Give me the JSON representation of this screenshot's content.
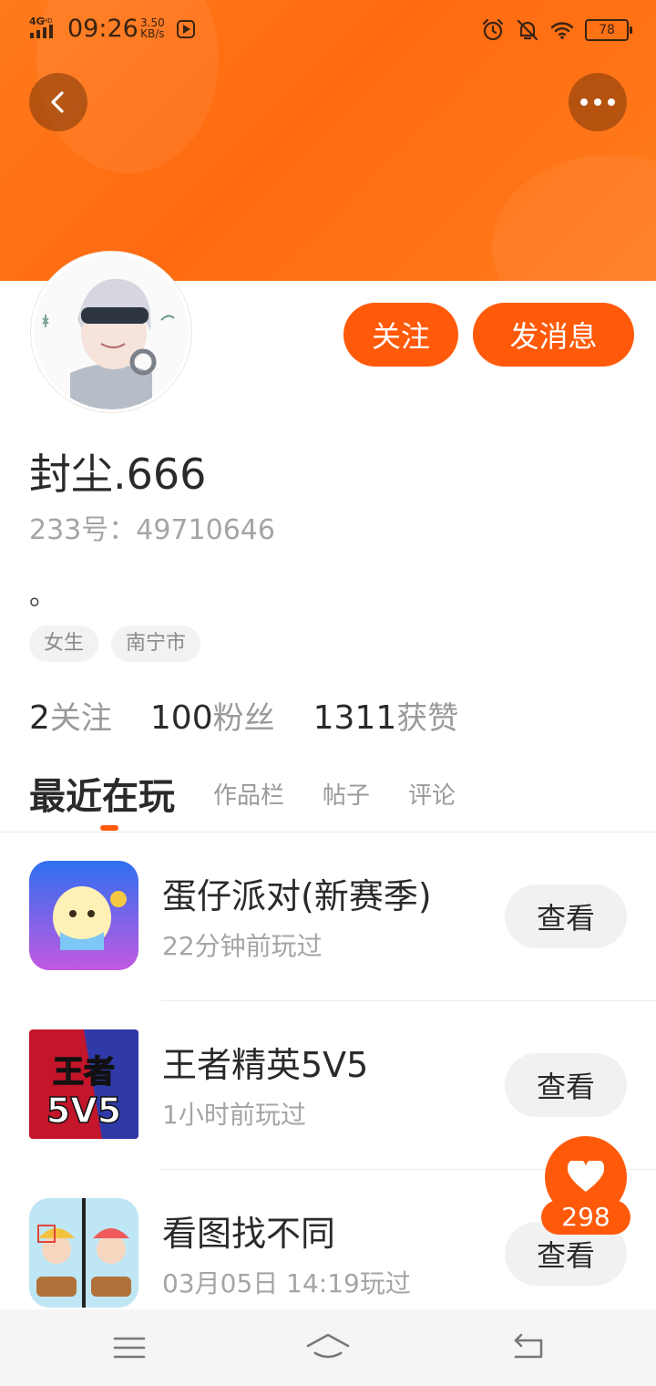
{
  "status_bar": {
    "network": "4G HD",
    "time": "09:26",
    "speed_value": "3.50",
    "speed_unit": "KB/s",
    "battery": "78",
    "icons": [
      "alarm-icon",
      "bell-off-icon",
      "wifi-icon"
    ]
  },
  "colors": {
    "accent": "#ff5a0a",
    "header": "#ff7a1c"
  },
  "profile": {
    "follow_label": "关注",
    "message_label": "发消息",
    "username": "封尘.666",
    "id_text": "233号：49710646",
    "bio": "。",
    "tags": [
      "女生",
      "南宁市"
    ],
    "stats": [
      {
        "num": "2",
        "label": "关注"
      },
      {
        "num": "100",
        "label": "粉丝"
      },
      {
        "num": "1311",
        "label": "获赞"
      }
    ]
  },
  "tabs": [
    "最近在玩",
    "作品栏",
    "帖子",
    "评论"
  ],
  "games": [
    {
      "name": "蛋仔派对(新赛季)",
      "time": "22分钟前玩过",
      "button": "查看",
      "icon": "eggy-party-icon"
    },
    {
      "name": "王者精英5V5",
      "time": "1小时前玩过",
      "button": "查看",
      "icon": "5v5-icon"
    },
    {
      "name": "看图找不同",
      "time": "03月05日 14:19玩过",
      "button": "查看",
      "icon": "spot-difference-icon"
    }
  ],
  "like": {
    "count": "298"
  }
}
